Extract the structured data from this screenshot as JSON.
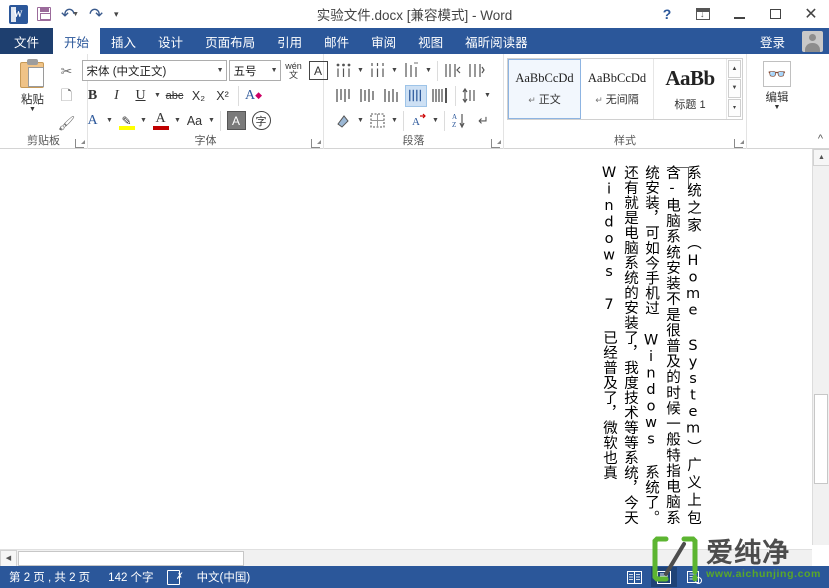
{
  "window": {
    "title": "实验文件.docx [兼容模式] - Word",
    "quick_access": [
      {
        "name": "word-logo",
        "label": "W"
      },
      {
        "name": "save-icon",
        "label": "保存"
      },
      {
        "name": "undo-icon",
        "label": "撤消"
      },
      {
        "name": "redo-icon",
        "label": "重复"
      },
      {
        "name": "customize-qat-icon",
        "label": "自定义快速访问工具栏"
      }
    ],
    "controls": {
      "help": "?",
      "ribbon_display": "功能区显示选项",
      "minimize": "最小化",
      "maximize": "最大化",
      "close": "关闭"
    }
  },
  "ribbon": {
    "tabs": [
      {
        "label": "文件",
        "state": "file"
      },
      {
        "label": "开始",
        "state": "active"
      },
      {
        "label": "插入",
        "state": "normal"
      },
      {
        "label": "设计",
        "state": "normal"
      },
      {
        "label": "页面布局",
        "state": "normal"
      },
      {
        "label": "引用",
        "state": "normal"
      },
      {
        "label": "邮件",
        "state": "normal"
      },
      {
        "label": "审阅",
        "state": "normal"
      },
      {
        "label": "视图",
        "state": "normal"
      },
      {
        "label": "福昕阅读器",
        "state": "normal"
      }
    ],
    "signin": "登录",
    "groups": {
      "clipboard": {
        "label": "剪贴板",
        "paste": "粘贴",
        "cut": "剪切",
        "copy": "复制",
        "format_painter": "格式刷"
      },
      "font": {
        "label": "字体",
        "font_name": "宋体 (中文正文)",
        "font_size": "五号",
        "bold": "B",
        "italic": "I",
        "underline": "U",
        "strikethrough": "abc",
        "subscript": "X₂",
        "superscript": "X²",
        "clear_format": "清除所有格式",
        "text_effects": "A",
        "highlight": "突出显示",
        "font_color": "字体颜色",
        "change_case": "Aa",
        "grow_font": "A",
        "shrink_font": "A",
        "phonetic_guide": "拼音指南",
        "char_border": "字符边框",
        "char_shading": "字符底纹",
        "enclose_char": "带圈字符"
      },
      "paragraph": {
        "label": "段落",
        "bullets": "项目符号",
        "numbering": "编号",
        "multilevel": "多级列表",
        "decrease_indent": "减少缩进量",
        "increase_indent": "增加缩进量",
        "align_top": "顶端对齐",
        "align_center": "居中",
        "align_bottom": "底端对齐",
        "justify_selected": "两端对齐",
        "distribute": "分散对齐",
        "line_spacing": "行和段落间距",
        "shading": "底纹",
        "borders": "边框",
        "sort": "排序",
        "show_marks": "显示编辑标记",
        "chinese_layout": "中文版式"
      },
      "styles": {
        "label": "样式",
        "items": [
          {
            "sample": "AaBbCcDd",
            "name": "正文",
            "selected": true,
            "size": "normal"
          },
          {
            "sample": "AaBbCcDd",
            "name": "无间隔",
            "selected": false,
            "size": "normal"
          },
          {
            "sample": "AaBb",
            "name": "标题 1",
            "selected": false,
            "size": "big"
          }
        ]
      },
      "editing": {
        "label": "编辑",
        "caret": "▼"
      }
    },
    "collapse": "^"
  },
  "document": {
    "vertical_text": "系统之家（Home System）广义上包含-电脑系统安装不是很普及的时候一般特指电脑系统安装，可如今手机过 Windows 系统了。还有就是电脑系统的安装了，我度技术等等系统，今天 Windows 7 已经普及了，微软也真"
  },
  "statusbar": {
    "page": "第 2 页 , 共 2 页",
    "words": "142 个字",
    "proofing_icon": "proofing-errors-icon",
    "language": "中文(中国)",
    "views": [
      {
        "name": "read-mode-view-button",
        "label": "阅读视图",
        "selected": false
      },
      {
        "name": "print-layout-view-button",
        "label": "页面视图",
        "selected": true
      },
      {
        "name": "web-layout-view-button",
        "label": "Web 版式视图",
        "selected": false
      }
    ]
  },
  "watermark": {
    "brand": "爱纯净",
    "url": "www.aichunjing.com",
    "logo_color": "#5cb531"
  },
  "colors": {
    "accent": "#2b579a",
    "file_tab": "#1e3f6f",
    "selection": "#cde0f4",
    "font_color_bar": "#c00000",
    "highlight_bar": "#ffff00"
  }
}
